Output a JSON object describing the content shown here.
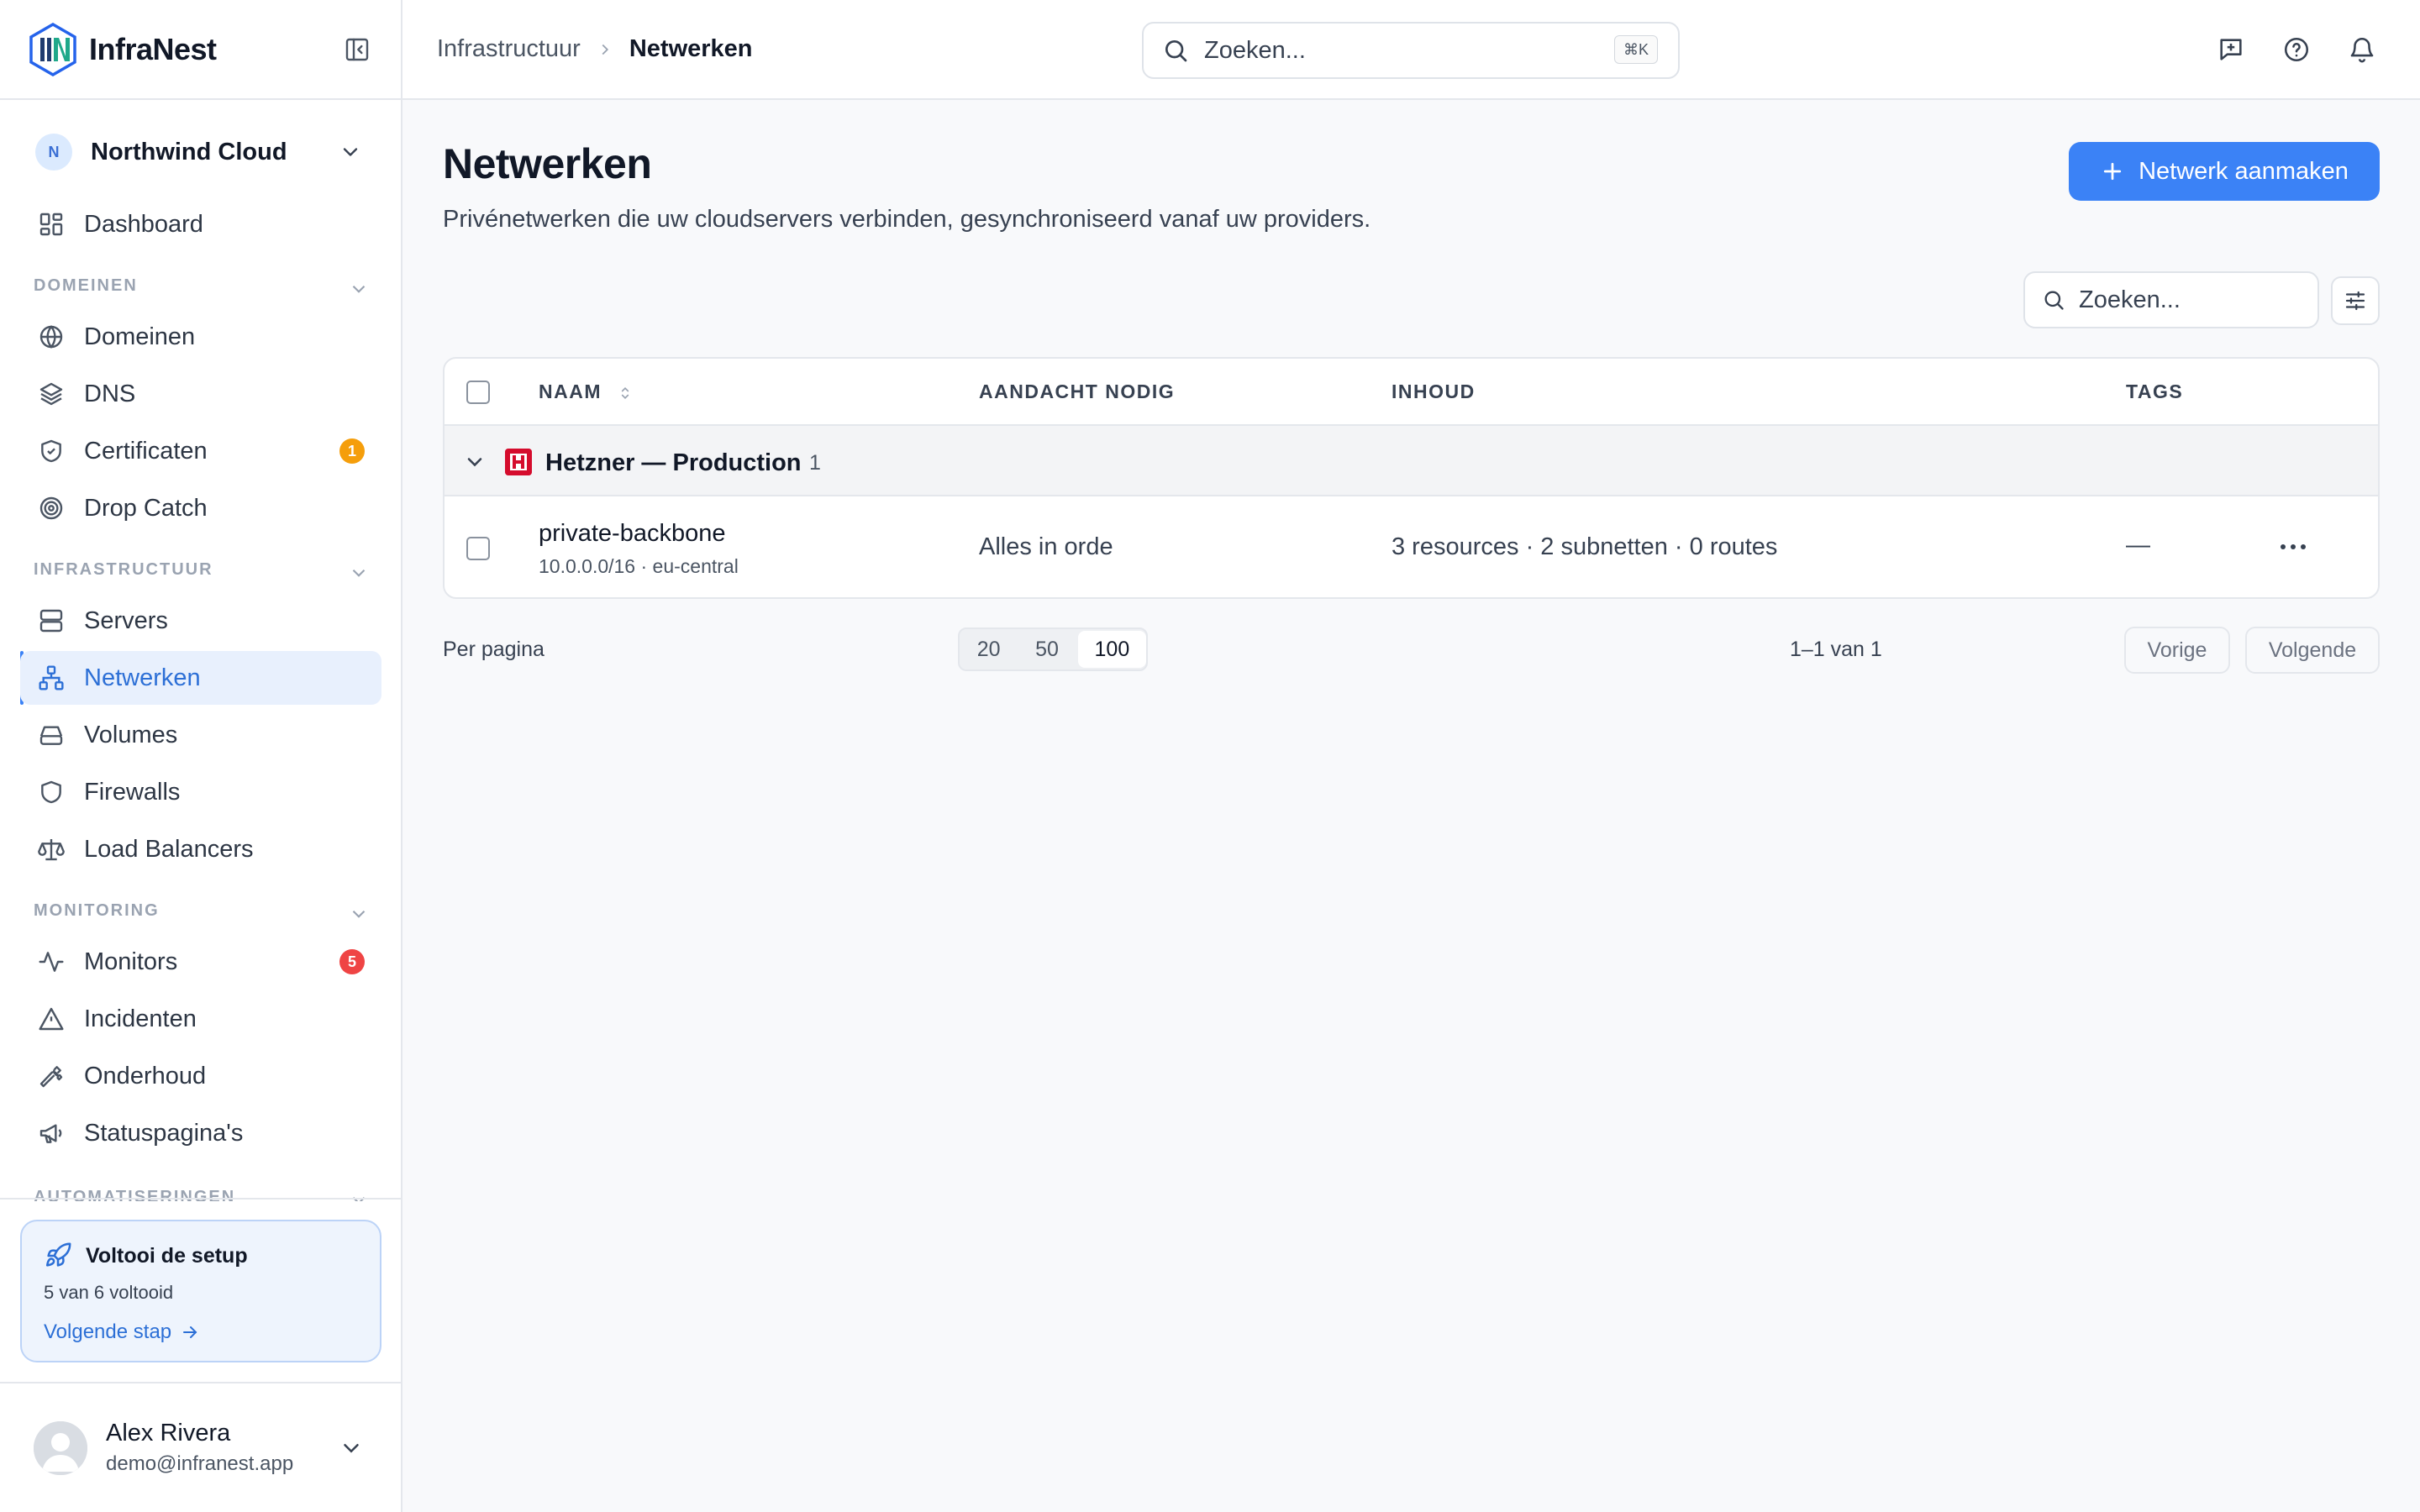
{
  "app": {
    "name": "InfraNest"
  },
  "org": {
    "initial": "N",
    "name": "Northwind Cloud"
  },
  "sidebar": {
    "dashboard": "Dashboard",
    "sections": {
      "domains": "DOMEINEN",
      "infra": "INFRASTRUCTUUR",
      "monitoring": "MONITORING",
      "automation": "AUTOMATISERINGEN"
    },
    "items": {
      "domeinen": "Domeinen",
      "dns": "DNS",
      "certificaten": "Certificaten",
      "certificaten_badge": "1",
      "dropcatch": "Drop Catch",
      "servers": "Servers",
      "netwerken": "Netwerken",
      "volumes": "Volumes",
      "firewalls": "Firewalls",
      "loadbalancers": "Load Balancers",
      "monitors": "Monitors",
      "monitors_badge": "5",
      "incidenten": "Incidenten",
      "onderhoud": "Onderhoud",
      "statuspaginas": "Statuspagina's"
    },
    "badge_colors": {
      "warning": "#f59e0b",
      "danger": "#ef4444"
    }
  },
  "setup": {
    "title": "Voltooi de setup",
    "progress": "5 van 6 voltooid",
    "link": "Volgende stap"
  },
  "user": {
    "name": "Alex Rivera",
    "email": "demo@infranest.app"
  },
  "topbar": {
    "breadcrumb": [
      "Infrastructuur",
      "Netwerken"
    ],
    "search_placeholder": "Zoeken...",
    "shortcut": "⌘K"
  },
  "page": {
    "title": "Netwerken",
    "description": "Privénetwerken die uw cloudservers verbinden, gesynchroniseerd vanaf uw providers.",
    "create_button": "Netwerk aanmaken",
    "table_search_placeholder": "Zoeken...",
    "accent": "#3b82f6"
  },
  "table": {
    "columns": [
      "NAAM",
      "AANDACHT NODIG",
      "INHOUD",
      "TAGS"
    ],
    "group": {
      "name": "Hetzner — Production",
      "count": "1"
    },
    "rows": [
      {
        "name": "private-backbone",
        "sub": "10.0.0.0/16 · eu-central",
        "attention": "Alles in orde",
        "content": "3 resources · 2 subnetten · 0 routes",
        "tags": "—"
      }
    ]
  },
  "pagination": {
    "label": "Per pagina",
    "sizes": [
      "20",
      "50",
      "100"
    ],
    "selected": "100",
    "info": "1–1 van 1",
    "prev": "Vorige",
    "next": "Volgende"
  }
}
